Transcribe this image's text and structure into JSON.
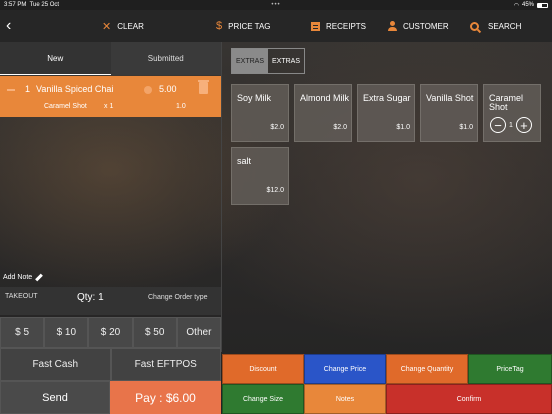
{
  "status": {
    "time": "3:57 PM",
    "date": "Tue 25 Oct",
    "dots": "•••",
    "battery": "45%"
  },
  "toolbar": {
    "back": "‹",
    "clear": "CLEAR",
    "price_tag": "PRICE TAG",
    "receipts": "RECEIPTS",
    "customer": "CUSTOMER",
    "search": "SEARCH"
  },
  "tabs": [
    "New",
    "Submitted"
  ],
  "order": {
    "qty": "1",
    "name": "Vanilla Spiced Chai",
    "price": "5.00",
    "modifier": {
      "name": "Caramel Shot",
      "qty": "x 1",
      "price": "1.0"
    }
  },
  "add_note": "Add Note",
  "summary": {
    "type": "TAKEOUT",
    "qty": "Qty: 1",
    "change": "Change Order type"
  },
  "cash_buttons": [
    "$ 5",
    "$ 10",
    "$ 20",
    "$ 50",
    "Other"
  ],
  "fast": {
    "cash": "Fast Cash",
    "eftpos": "Fast EFTPOS"
  },
  "send": "Send",
  "pay": "Pay : $6.00",
  "extra_tabs": [
    "EXTRAS",
    "EXTRAS"
  ],
  "items": [
    {
      "name": "Soy Milk",
      "price": "$2.0"
    },
    {
      "name": "Almond Milk",
      "price": "$2.0"
    },
    {
      "name": "Extra Sugar",
      "price": "$1.0"
    },
    {
      "name": "Vanilla Shot",
      "price": "$1.0"
    },
    {
      "name": "Caramel Shot",
      "qty": "1"
    },
    {
      "name": "salt",
      "price": "$12.0"
    }
  ],
  "actions": [
    {
      "label": "Discount",
      "color": "#e06a2a"
    },
    {
      "label": "Change Price",
      "color": "#2a55c8"
    },
    {
      "label": "Change Quantity",
      "color": "#e06a2a"
    },
    {
      "label": "PriceTag",
      "color": "#2f7a30"
    },
    {
      "label": "Change Size",
      "color": "#2f7a30"
    },
    {
      "label": "Notes",
      "color": "#e8873a"
    },
    {
      "label": "Confirm",
      "color": "#c8302a"
    }
  ]
}
